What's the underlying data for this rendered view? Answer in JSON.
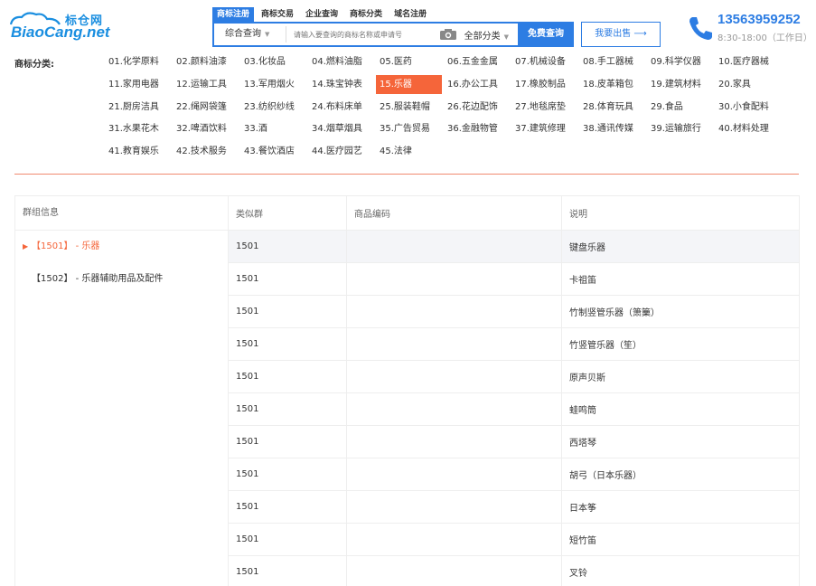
{
  "logo": {
    "cn": "标仓网",
    "en": "BiaoCang.net"
  },
  "nav": [
    "商标注册",
    "商标交易",
    "企业查询",
    "商标分类",
    "域名注册"
  ],
  "search": {
    "type_label": "综合查询",
    "placeholder": "请输入要查询的商标名称或申请号",
    "category_label": "全部分类",
    "button_label": "免费查询"
  },
  "sell_button": "我要出售 ⟶",
  "contact": {
    "phone": "13563959252",
    "hours": "8:30-18:00（工作日）"
  },
  "category_label": "商标分类:",
  "categories": [
    "01.化学原料",
    "02.颜料油漆",
    "03.化妆品",
    "04.燃料油脂",
    "05.医药",
    "06.五金金属",
    "07.机械设备",
    "08.手工器械",
    "09.科学仪器",
    "10.医疗器械",
    "11.家用电器",
    "12.运输工具",
    "13.军用烟火",
    "14.珠宝钟表",
    "15.乐器",
    "16.办公工具",
    "17.橡胶制品",
    "18.皮革箱包",
    "19.建筑材料",
    "20.家具",
    "21.厨房洁具",
    "22.绳网袋篷",
    "23.纺织纱线",
    "24.布料床单",
    "25.服装鞋帽",
    "26.花边配饰",
    "27.地毯席垫",
    "28.体育玩具",
    "29.食品",
    "30.小食配料",
    "31.水果花木",
    "32.啤酒饮料",
    "33.酒",
    "34.烟草烟具",
    "35.广告贸易",
    "36.金融物管",
    "37.建筑修理",
    "38.通讯传媒",
    "39.运输旅行",
    "40.材料处理",
    "41.教育娱乐",
    "42.技术服务",
    "43.餐饮酒店",
    "44.医疗园艺",
    "45.法律"
  ],
  "group_panel": {
    "header": "群组信息",
    "items": [
      "【1501】 - 乐器",
      "【1502】 - 乐器辅助用品及配件"
    ]
  },
  "table": {
    "headers": [
      "类似群",
      "商品编码",
      "说明"
    ],
    "rows": [
      [
        "1501",
        "",
        "键盘乐器"
      ],
      [
        "1501",
        "",
        "卡祖笛"
      ],
      [
        "1501",
        "",
        "竹制竖管乐器（箫篥）"
      ],
      [
        "1501",
        "",
        "竹竖管乐器（笙）"
      ],
      [
        "1501",
        "",
        "原声贝斯"
      ],
      [
        "1501",
        "",
        "蛙鸣筒"
      ],
      [
        "1501",
        "",
        "西塔琴"
      ],
      [
        "1501",
        "",
        "胡弓（日本乐器）"
      ],
      [
        "1501",
        "",
        "日本筝"
      ],
      [
        "1501",
        "",
        "短竹笛"
      ],
      [
        "1501",
        "",
        "叉铃"
      ]
    ]
  },
  "colors": {
    "primary": "#2d7de3",
    "accent": "#f5653a"
  }
}
